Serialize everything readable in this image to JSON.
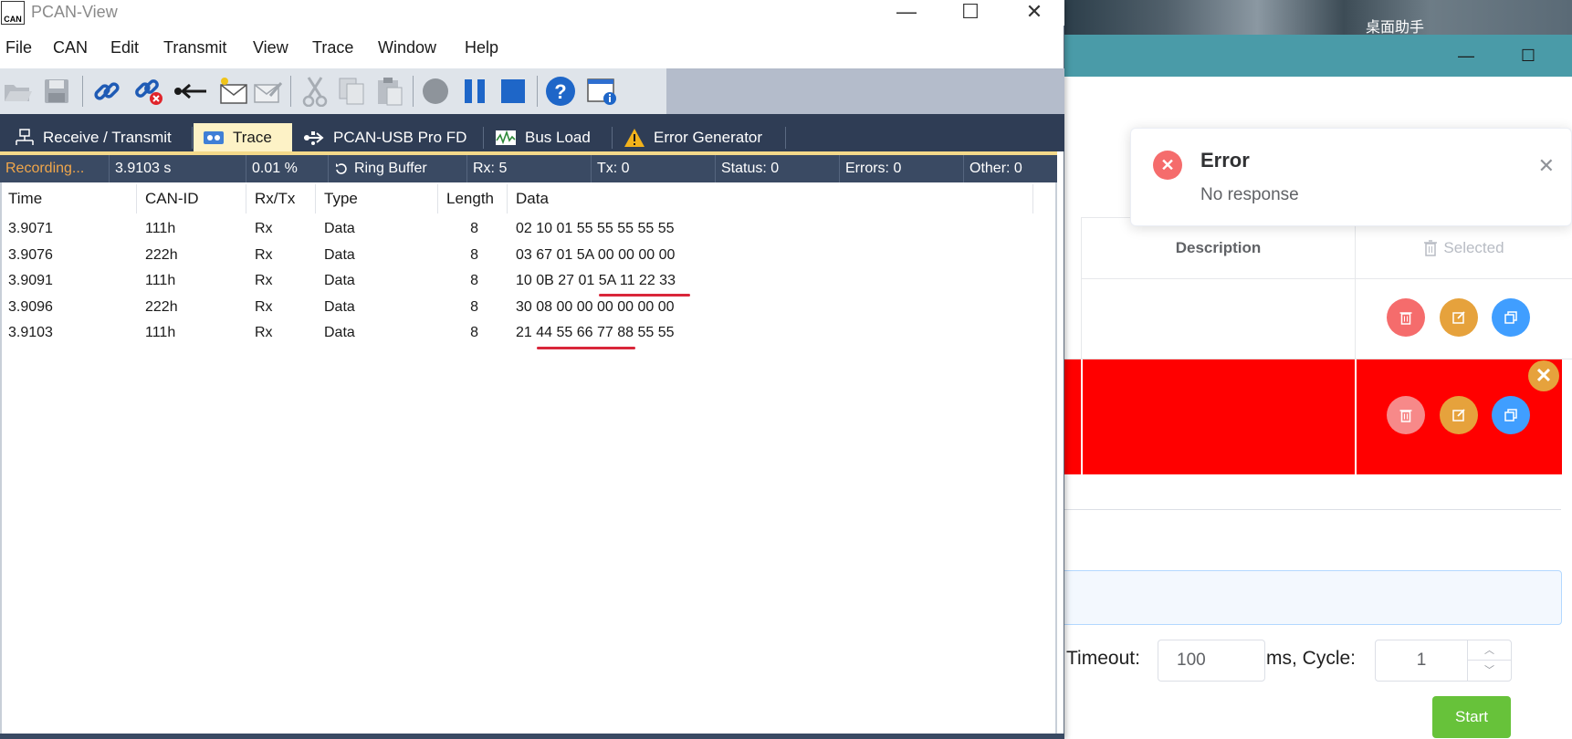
{
  "background_app": {
    "desktop_helper_label": "桌面助手",
    "window_minimize": "—",
    "window_maximize": "☐",
    "table": {
      "col_description": "Description",
      "col_selected": "Selected"
    },
    "toast": {
      "title": "Error",
      "message": "No response",
      "close": "✕"
    },
    "form": {
      "timeout_label": "Timeout:",
      "timeout_value": "100",
      "cycle_label": "ms, Cycle:",
      "cycle_value": "1",
      "spin_up": "︿",
      "spin_down": "﹀",
      "start_label": "Start"
    },
    "colors": {
      "highlight_row": "#ff0000",
      "start_button": "#67c23a",
      "delete": "#f56c6c",
      "edit": "#e6a23c",
      "copy": "#409eff"
    }
  },
  "pcan": {
    "title": "PCAN-View",
    "icon_text": "CAN",
    "window_controls": {
      "minimize": "—",
      "maximize": "☐",
      "close": "✕"
    },
    "menu": [
      "File",
      "CAN",
      "Edit",
      "Transmit",
      "View",
      "Trace",
      "Window",
      "Help"
    ],
    "toolbar_icons": [
      "open-icon",
      "save-icon",
      "connect-icon",
      "disconnect-icon",
      "reset-icon",
      "new-message-icon",
      "edit-message-icon",
      "cut-icon",
      "copy-icon",
      "paste-icon",
      "record-icon",
      "pause-icon",
      "stop-icon",
      "help-icon",
      "about-icon"
    ],
    "tabs": [
      {
        "label": "Receive / Transmit",
        "icon": "network-icon",
        "active": false
      },
      {
        "label": "Trace",
        "icon": "trace-icon",
        "active": true
      },
      {
        "label": "PCAN-USB Pro FD",
        "icon": "usb-icon",
        "active": false
      },
      {
        "label": "Bus Load",
        "icon": "busload-icon",
        "active": false
      },
      {
        "label": "Error Generator",
        "icon": "warning-icon",
        "active": false
      }
    ],
    "status": {
      "recording": "Recording...",
      "time": "3.9103 s",
      "load": "0.01 %",
      "buffer": "Ring Buffer",
      "rx": "Rx: 5",
      "tx": "Tx: 0",
      "status": "Status: 0",
      "errors": "Errors: 0",
      "other": "Other: 0"
    },
    "columns": [
      "Time",
      "CAN-ID",
      "Rx/Tx",
      "Type",
      "Length",
      "Data"
    ],
    "rows": [
      {
        "time": "3.9071",
        "id": "111h",
        "dir": "Rx",
        "type": "Data",
        "len": "8",
        "data": "02 10 01 55 55 55 55 55"
      },
      {
        "time": "3.9076",
        "id": "222h",
        "dir": "Rx",
        "type": "Data",
        "len": "8",
        "data": "03 67 01 5A 00 00 00 00"
      },
      {
        "time": "3.9091",
        "id": "111h",
        "dir": "Rx",
        "type": "Data",
        "len": "8",
        "data": "10 0B 27 01 5A 11 22 33"
      },
      {
        "time": "3.9096",
        "id": "222h",
        "dir": "Rx",
        "type": "Data",
        "len": "8",
        "data": "30 08 00 00 00 00 00 00"
      },
      {
        "time": "3.9103",
        "id": "111h",
        "dir": "Rx",
        "type": "Data",
        "len": "8",
        "data": "21 44 55 66 77 88 55 55"
      }
    ],
    "annotation_color": "#d9263a"
  }
}
